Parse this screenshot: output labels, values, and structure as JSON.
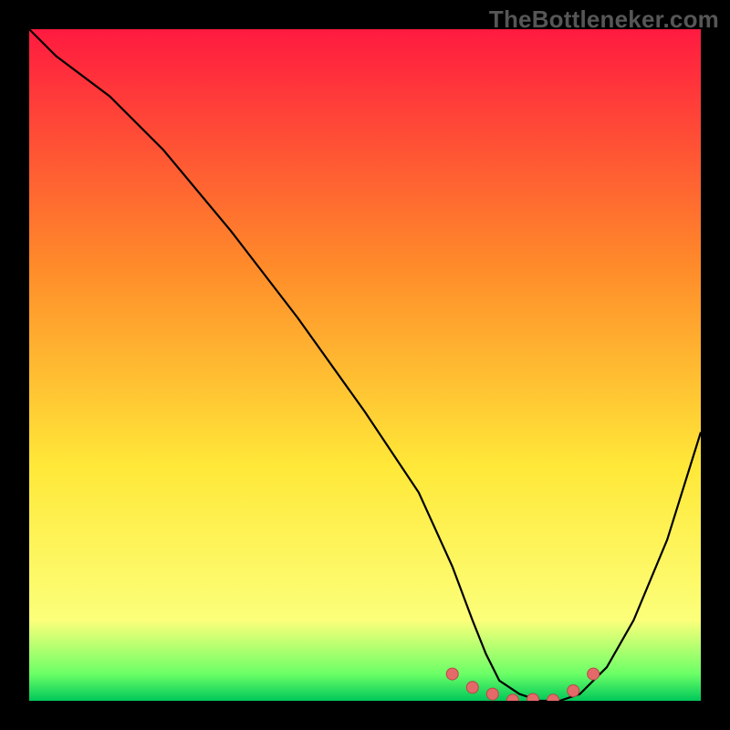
{
  "watermark": "TheBottleneker.com",
  "colors": {
    "grad_top": "#ff1a40",
    "grad_mid1": "#ff8a2a",
    "grad_mid2": "#ffe838",
    "grad_low": "#fcff7a",
    "grad_green1": "#6bff66",
    "grad_green2": "#00c85a",
    "curve": "#000000",
    "marker_fill": "#e46a6a",
    "marker_stroke": "#b84848",
    "frame": "#000000"
  },
  "chart_data": {
    "type": "line",
    "title": "",
    "xlabel": "",
    "ylabel": "",
    "xlim": [
      0,
      100
    ],
    "ylim": [
      0,
      100
    ],
    "series": [
      {
        "name": "bottleneck-curve",
        "x": [
          0,
          4,
          12,
          20,
          30,
          40,
          50,
          58,
          63,
          66,
          68,
          70,
          73,
          76,
          79,
          82,
          86,
          90,
          95,
          100
        ],
        "y": [
          100,
          96,
          90,
          82,
          70,
          57,
          43,
          31,
          20,
          12,
          7,
          3,
          1,
          0,
          0,
          1,
          5,
          12,
          24,
          40
        ]
      }
    ],
    "markers": {
      "name": "minimum-band",
      "x": [
        63,
        66,
        69,
        72,
        75,
        78,
        81,
        84
      ],
      "y": [
        4,
        2,
        1,
        0.1,
        0.2,
        0.1,
        1.5,
        4
      ]
    }
  }
}
